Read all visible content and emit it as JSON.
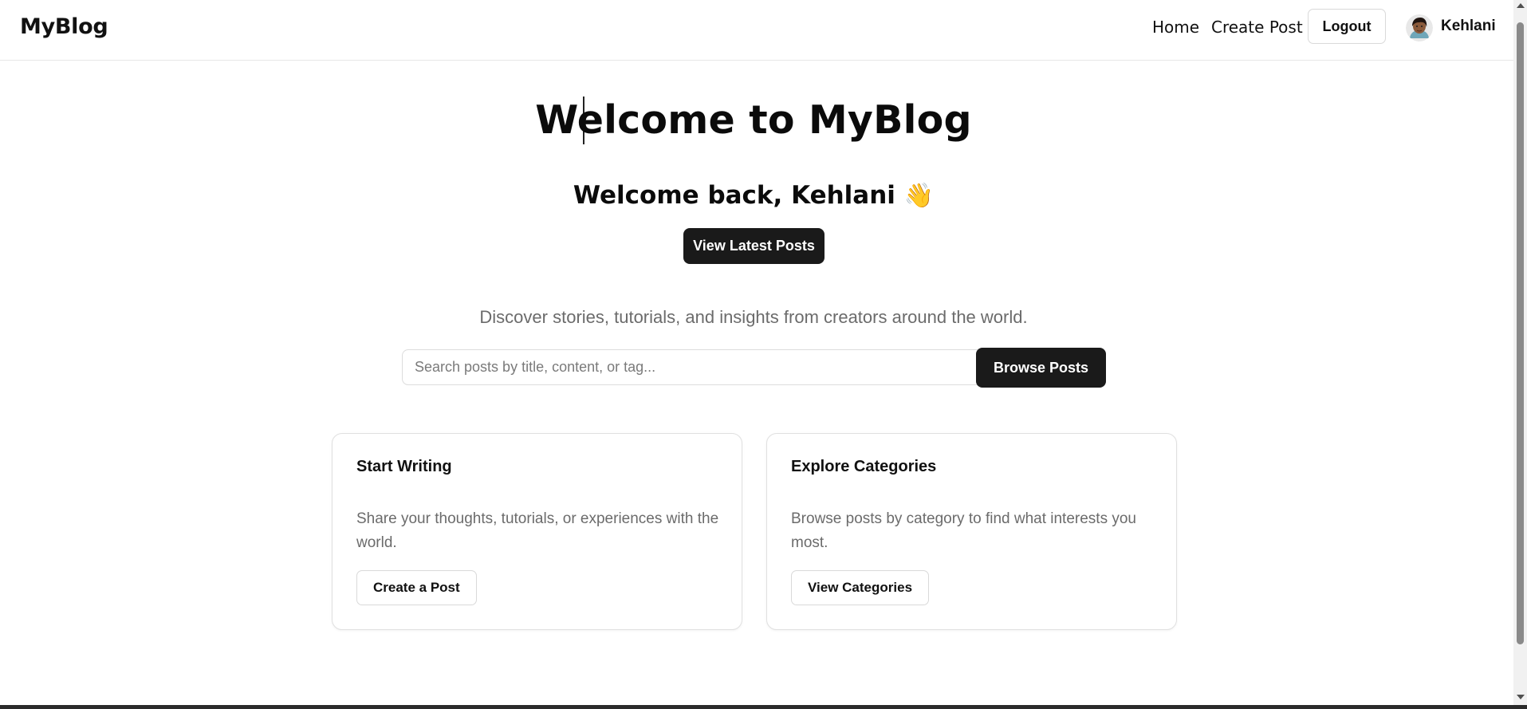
{
  "header": {
    "brand": "MyBlog",
    "nav": {
      "home": "Home",
      "create_post": "Create Post"
    },
    "logout_label": "Logout",
    "user_name": "Kehlani",
    "avatar_icon": "user-avatar-icon"
  },
  "hero": {
    "title": "Welcome to MyBlog",
    "welcome_back": "Welcome back, Kehlani",
    "wave_emoji": "👋",
    "latest_posts_label": "View Latest Posts",
    "tagline": "Discover stories, tutorials, and insights from creators around the world."
  },
  "search": {
    "placeholder": "Search posts by title, content, or tag...",
    "value": "",
    "browse_label": "Browse Posts"
  },
  "cards": [
    {
      "title": "Start Writing",
      "description": "Share your thoughts, tutorials, or experiences with the world.",
      "button_label": "Create a Post"
    },
    {
      "title": "Explore Categories",
      "description": "Browse posts by category to find what interests you most.",
      "button_label": "View Categories"
    }
  ],
  "colors": {
    "primary_button": "#1a1a1a",
    "muted_text": "#6b6b6b",
    "border": "#e0e0e0"
  }
}
